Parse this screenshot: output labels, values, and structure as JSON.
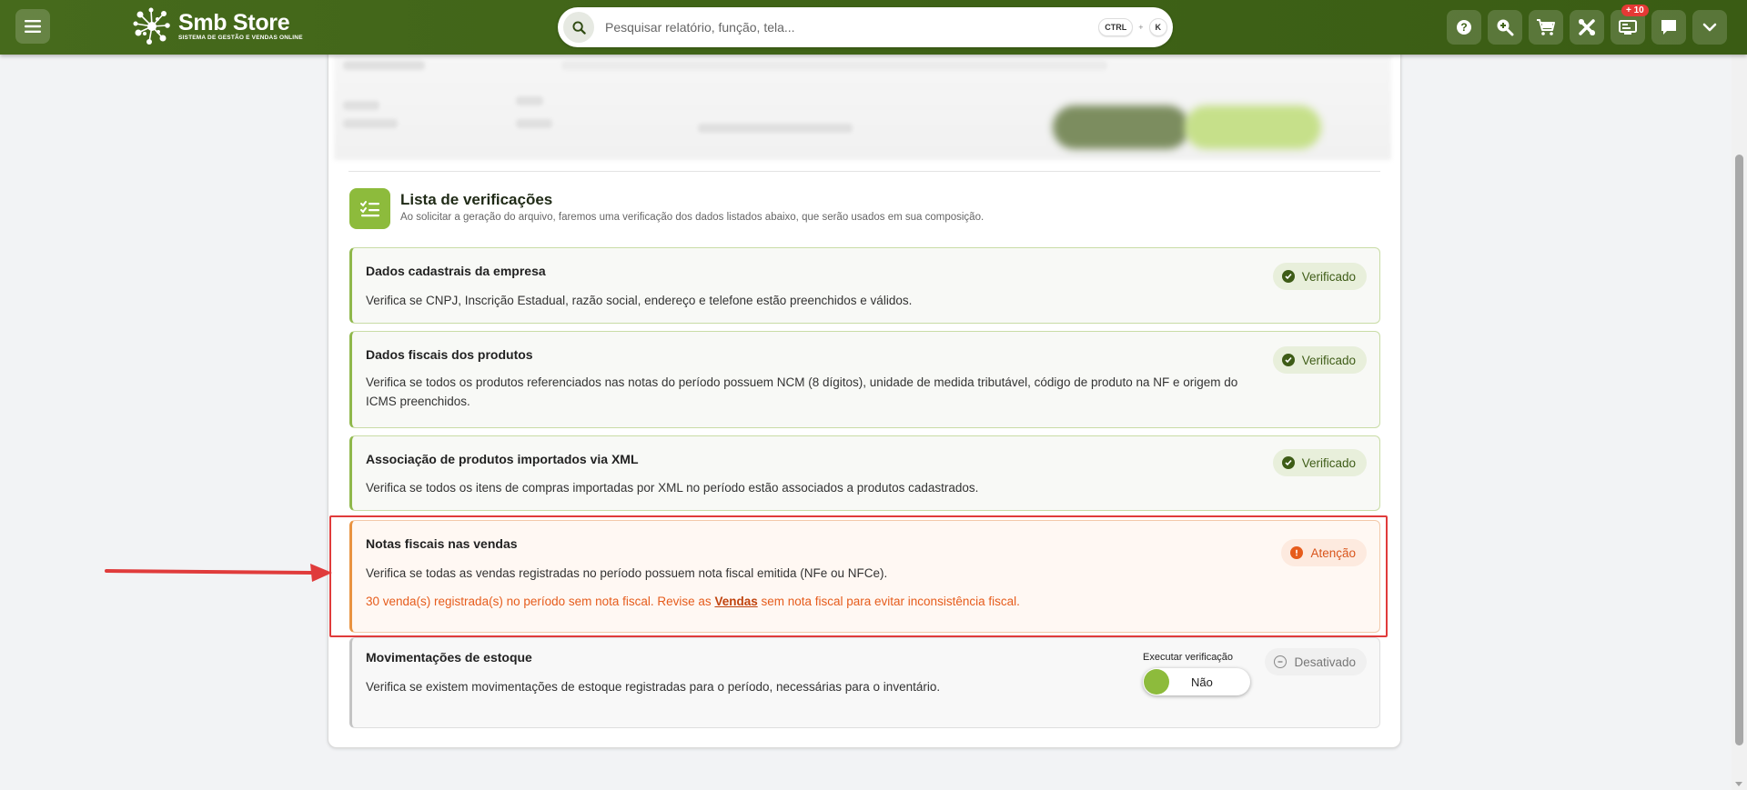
{
  "app": {
    "name": "Smb Store",
    "tagline": "SISTEMA DE GESTÃO E VENDAS ONLINE"
  },
  "search": {
    "placeholder": "Pesquisar relatório, função, tela...",
    "shortcut_key1": "CTRL",
    "shortcut_plus": "+",
    "shortcut_key2": "K"
  },
  "toolbar": {
    "icons": [
      "help-icon",
      "zoom-icon",
      "cart-icon",
      "tools-icon",
      "pos-icon",
      "chat-icon",
      "chevron-down-icon"
    ],
    "notification_badge": "+ 10"
  },
  "checklist": {
    "title": "Lista de verificações",
    "subtitle": "Ao solicitar a geração do arquivo, faremos uma verificação dos dados listados abaixo, que serão usados em sua composição.",
    "items": [
      {
        "title": "Dados cadastrais da empresa",
        "description": "Verifica se CNPJ, Inscrição Estadual, razão social, endereço e telefone estão preenchidos e válidos.",
        "status": "Verificado"
      },
      {
        "title": "Dados fiscais dos produtos",
        "description": "Verifica se todos os produtos referenciados nas notas do período possuem NCM (8 dígitos), unidade de medida tributável, código de produto na NF e origem do ICMS preenchidos.",
        "status": "Verificado"
      },
      {
        "title": "Associação de produtos importados via XML",
        "description": "Verifica se todos os itens de compras importadas por XML no período estão associados a produtos cadastrados.",
        "status": "Verificado"
      },
      {
        "title": "Notas fiscais nas vendas",
        "description": "Verifica se todas as vendas registradas no período possuem nota fiscal emitida (NFe ou NFCe).",
        "status": "Atenção",
        "warning_before": "30 venda(s) registrada(s) no período sem nota fiscal. Revise as ",
        "warning_link": "Vendas",
        "warning_after": " sem nota fiscal para evitar inconsistência fiscal."
      },
      {
        "title": "Movimentações de estoque",
        "description": "Verifica se existem movimentações de estoque registradas para o período, necessárias para o inventário.",
        "status": "Desativado",
        "toggle_label": "Executar verificação",
        "toggle_value": "Não"
      }
    ]
  },
  "colors": {
    "topbar": "#3f6317",
    "accent": "#8dbb3c",
    "verified": "#3e5c17",
    "warning": "#e65c1c",
    "highlight": "#e03b3b"
  }
}
